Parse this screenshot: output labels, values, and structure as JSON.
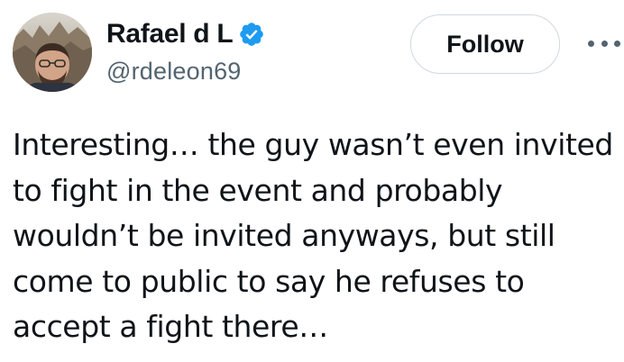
{
  "author": {
    "display_name": "Rafael d L",
    "handle": "@rdeleon69",
    "verified": true,
    "verified_color": "#1d9bf0"
  },
  "actions": {
    "follow_label": "Follow",
    "more_icon": "more-horizontal-icon"
  },
  "tweet": {
    "lines": [
      "Interesting… the guy wasn’t even invited",
      "to fight in the event and probably",
      "wouldn’t be invited anyways, but still",
      "come to public to say he refuses to",
      "accept a fight there…"
    ]
  }
}
